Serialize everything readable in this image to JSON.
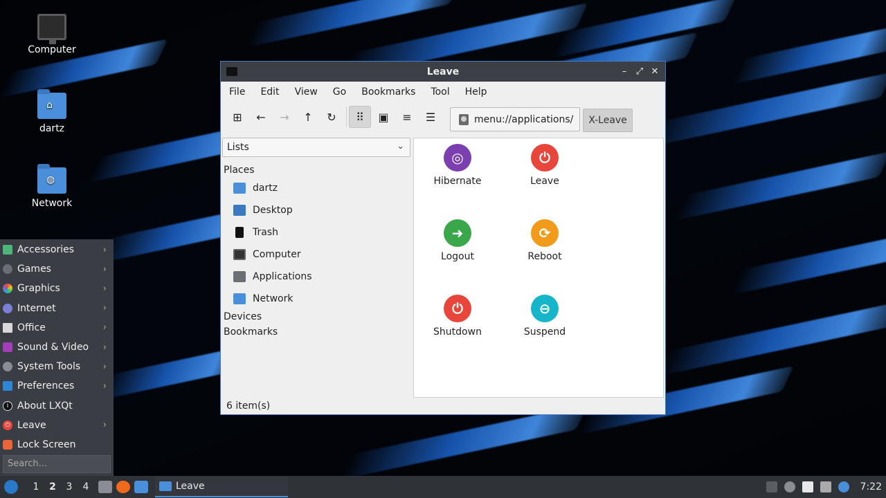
{
  "desktop": {
    "icons": [
      {
        "label": "Computer",
        "icon": "computer-icon"
      },
      {
        "label": "dartz",
        "icon": "home-folder-icon"
      },
      {
        "label": "Network",
        "icon": "network-folder-icon"
      }
    ]
  },
  "start_menu": {
    "items": [
      {
        "label": "Accessories",
        "icon": "accessories-icon",
        "submenu": true
      },
      {
        "label": "Games",
        "icon": "games-icon",
        "submenu": true
      },
      {
        "label": "Graphics",
        "icon": "graphics-icon",
        "submenu": true
      },
      {
        "label": "Internet",
        "icon": "internet-icon",
        "submenu": true
      },
      {
        "label": "Office",
        "icon": "office-icon",
        "submenu": true
      },
      {
        "label": "Sound & Video",
        "icon": "sound-video-icon",
        "submenu": true
      },
      {
        "label": "System Tools",
        "icon": "system-tools-icon",
        "submenu": true
      },
      {
        "label": "Preferences",
        "icon": "preferences-icon",
        "submenu": true
      },
      {
        "label": "About LXQt",
        "icon": "info-icon",
        "submenu": false
      },
      {
        "label": "Leave",
        "icon": "power-icon",
        "submenu": true
      },
      {
        "label": "Lock Screen",
        "icon": "lock-icon",
        "submenu": false
      }
    ],
    "search_placeholder": "Search..."
  },
  "window": {
    "title": "Leave",
    "menu": [
      "File",
      "Edit",
      "View",
      "Go",
      "Bookmarks",
      "Tool",
      "Help"
    ],
    "toolbar": [
      "new-tab-icon",
      "back-arrow-icon",
      "forward-arrow-icon",
      "up-arrow-icon",
      "reload-icon",
      "icon-view-icon",
      "thumbnail-view-icon",
      "compact-view-icon",
      "detailed-list-icon"
    ],
    "path": "menu://applications/",
    "path_button": "X-Leave",
    "sidebar": {
      "mode": "Lists",
      "places_header": "Places",
      "places": [
        {
          "label": "dartz",
          "icon": "home-folder-icon"
        },
        {
          "label": "Desktop",
          "icon": "desktop-icon"
        },
        {
          "label": "Trash",
          "icon": "trash-icon"
        },
        {
          "label": "Computer",
          "icon": "computer-icon"
        },
        {
          "label": "Applications",
          "icon": "applications-icon"
        },
        {
          "label": "Network",
          "icon": "network-folder-icon"
        }
      ],
      "devices_header": "Devices",
      "bookmarks_header": "Bookmarks"
    },
    "items": [
      {
        "label": "Hibernate",
        "icon": "hibernate-icon",
        "color": "#7b3fb0"
      },
      {
        "label": "Leave",
        "icon": "leave-power-icon",
        "color": "#e8463a"
      },
      {
        "label": "Logout",
        "icon": "logout-icon",
        "color": "#3aa84a"
      },
      {
        "label": "Reboot",
        "icon": "reboot-icon",
        "color": "#f29b1b"
      },
      {
        "label": "Shutdown",
        "icon": "shutdown-icon",
        "color": "#e8463a"
      },
      {
        "label": "Suspend",
        "icon": "suspend-icon",
        "color": "#17b5c9"
      }
    ],
    "status": "6 item(s)"
  },
  "taskbar": {
    "workspaces": [
      "1",
      "2",
      "3",
      "4"
    ],
    "current_workspace": "2",
    "task_label": "Leave",
    "clock": "7:22"
  }
}
